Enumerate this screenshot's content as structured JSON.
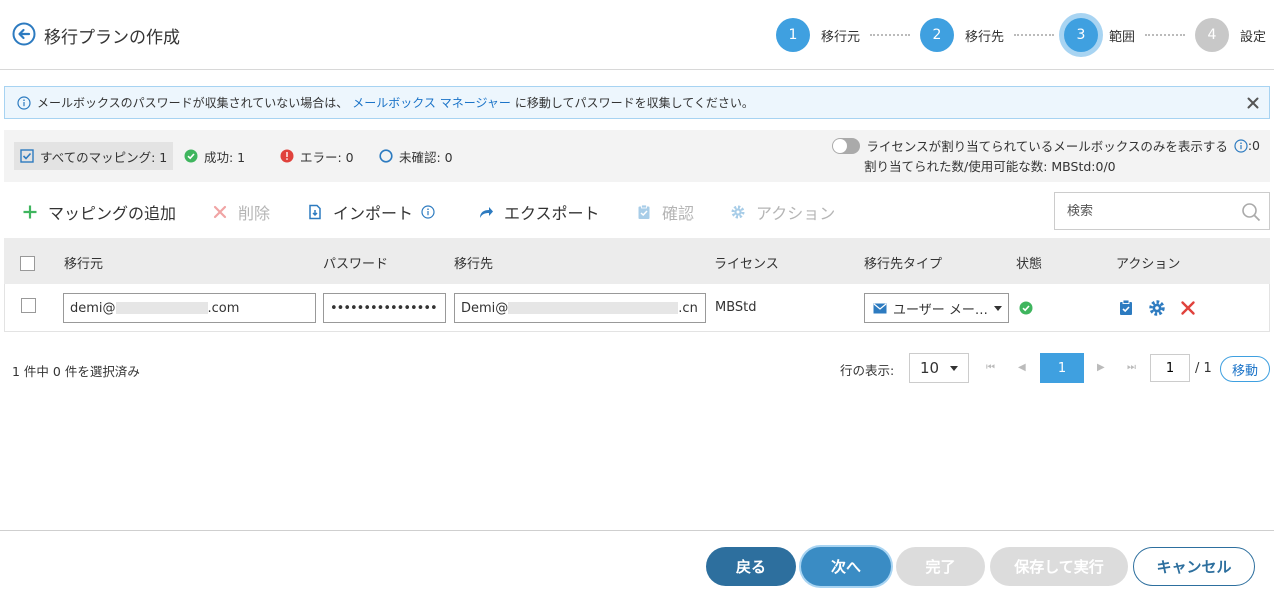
{
  "header": {
    "title": "移行プランの作成",
    "steps": [
      {
        "number": "1",
        "label": "移行元",
        "state": "done"
      },
      {
        "number": "2",
        "label": "移行先",
        "state": "done"
      },
      {
        "number": "3",
        "label": "範囲",
        "state": "current"
      },
      {
        "number": "4",
        "label": "設定",
        "state": "inactive"
      }
    ]
  },
  "banner": {
    "text_before": "メールボックスのパスワードが収集されていない場合は、",
    "link": "メールボックス マネージャー",
    "text_after": "に移動してパスワードを収集してください。"
  },
  "filters": {
    "all": "すべてのマッピング: 1",
    "success": "成功: 1",
    "error": "エラー: 0",
    "unconfirmed": "未確認: 0",
    "license_toggle_label": "ライセンスが割り当てられているメールボックスのみを表示する",
    "license_toggle_suffix": ":0",
    "license_count": "割り当てられた数/使用可能な数:  MBStd:0/0"
  },
  "toolbar": {
    "add": "マッピングの追加",
    "delete": "削除",
    "import": "インポート",
    "export": "エクスポート",
    "confirm": "確認",
    "action": "アクション",
    "search_placeholder": "検索"
  },
  "table": {
    "headers": {
      "source": "移行元",
      "password": "パスワード",
      "destination": "移行先",
      "license": "ライセンス",
      "dest_type": "移行先タイプ",
      "status": "状態",
      "actions": "アクション"
    },
    "rows": [
      {
        "source_prefix": "demi@",
        "source_suffix": ".com",
        "password": "••••••••••••••••",
        "dest_prefix": "Demi@",
        "dest_suffix": ".cn",
        "license": "MBStd",
        "dest_type": "ユーザー メー…",
        "status": "success"
      }
    ]
  },
  "pagination": {
    "selected": "1 件中 0 件を選択済み",
    "rows_label": "行の表示:",
    "rows_value": "10",
    "current_page": "1",
    "page_input": "1",
    "total": "/ 1",
    "go": "移動"
  },
  "footer": {
    "back": "戻る",
    "next": "次へ",
    "finish": "完了",
    "save_run": "保存して実行",
    "cancel": "キャンセル"
  }
}
